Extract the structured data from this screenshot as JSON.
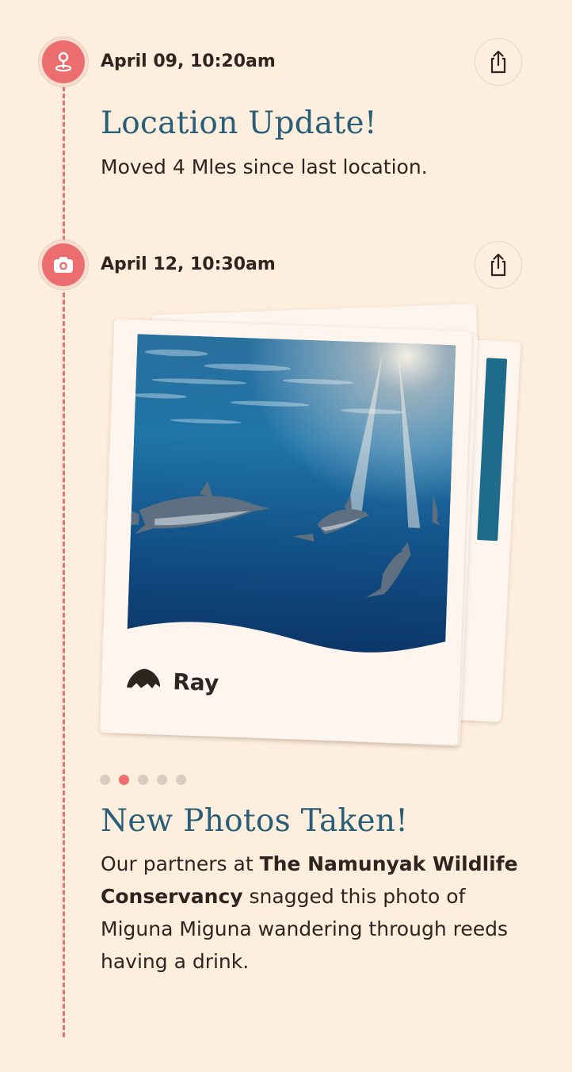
{
  "timeline": {
    "entries": [
      {
        "date": "April 09, 10:20am",
        "icon": "location-pin-icon",
        "title": "Location Update!",
        "body": "Moved 4 Mles since last location."
      },
      {
        "date": "April 12, 10:30am",
        "icon": "camera-icon",
        "title": "New Photos Taken!",
        "body_parts": [
          "Our partners at ",
          "The Namunyak Wildlife Conservancy",
          " snagged this photo of Miguna Miguna wandering through reeds having a drink."
        ],
        "photo": {
          "caption": "Ray",
          "caption_icon": "ray-icon"
        },
        "carousel": {
          "count": 5,
          "active_index": 1
        }
      }
    ]
  },
  "colors": {
    "background": "#fdeedd",
    "accent": "#ec6e6e",
    "title": "#285e78",
    "text": "#2e2520"
  }
}
